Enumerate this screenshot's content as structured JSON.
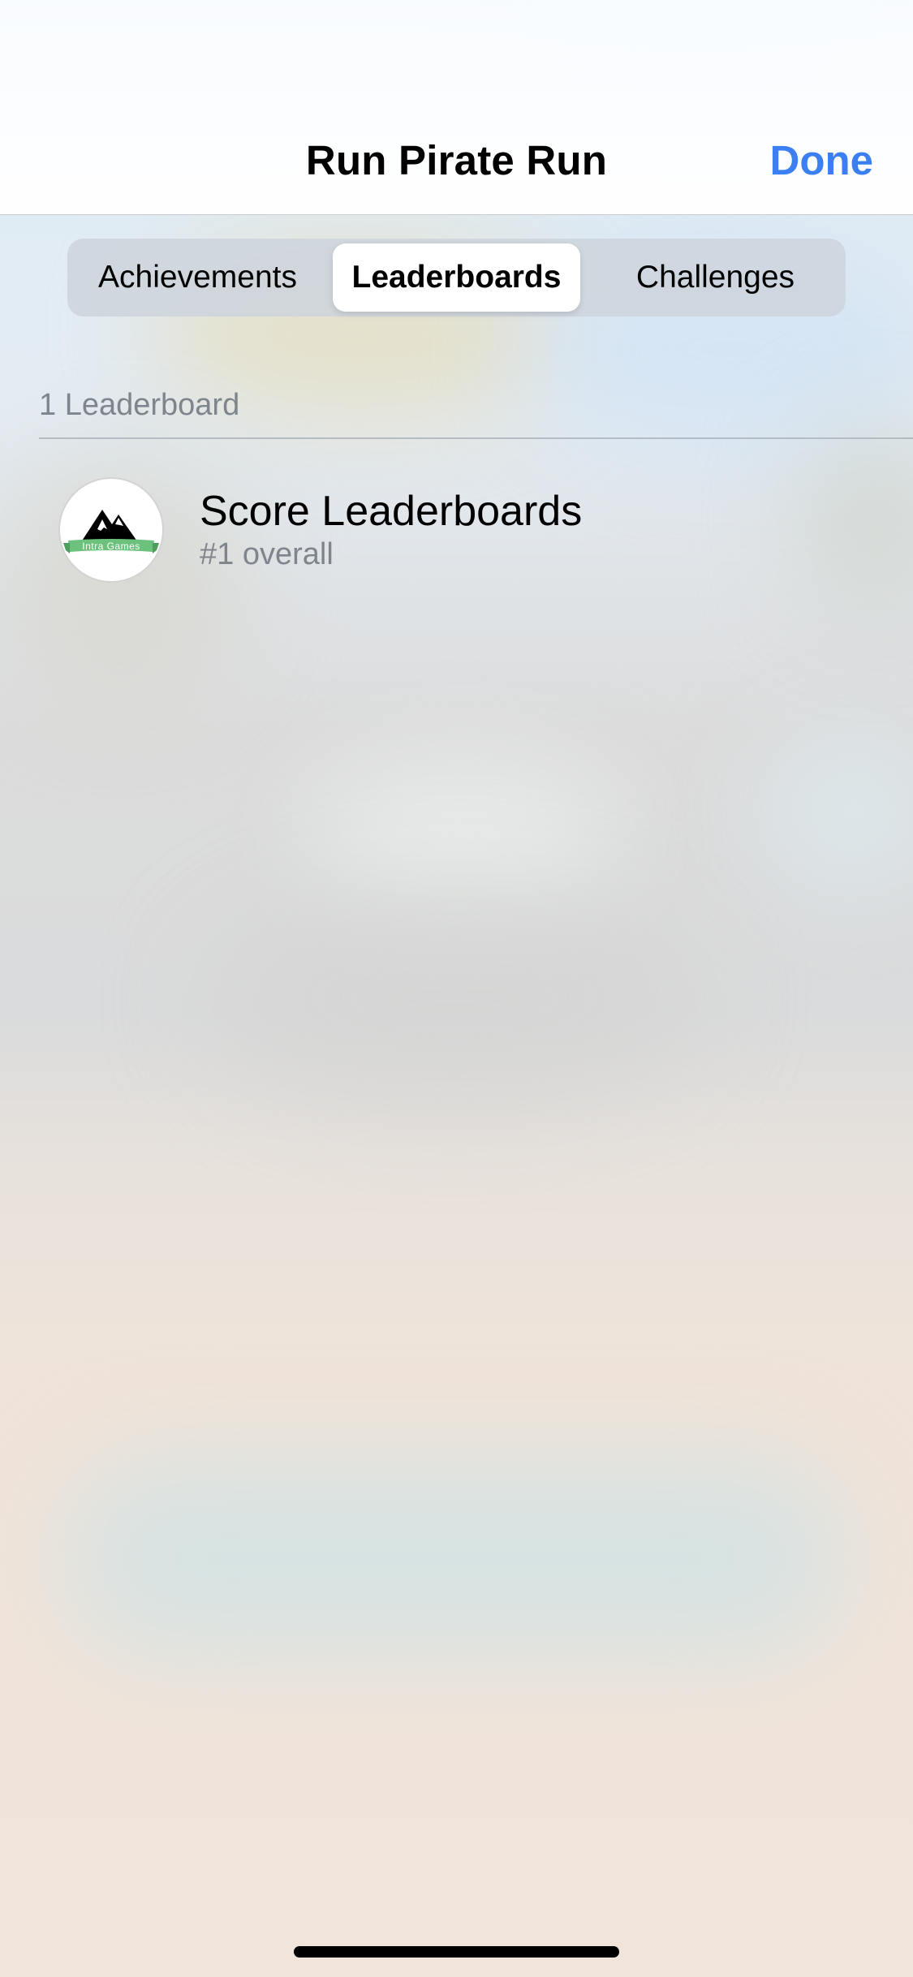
{
  "header": {
    "title": "Run Pirate Run",
    "done_label": "Done"
  },
  "segments": [
    {
      "label": "Achievements",
      "selected": false
    },
    {
      "label": "Leaderboards",
      "selected": true
    },
    {
      "label": "Challenges",
      "selected": false
    }
  ],
  "section": {
    "header": "1 Leaderboard"
  },
  "leaderboards": [
    {
      "title": "Score Leaderboards",
      "subtitle": "#1 overall",
      "icon": "intra-games-mountain-logo-icon",
      "logo_text": "Intra Games"
    }
  ],
  "colors": {
    "accent": "#3b7ff2",
    "logo_ribbon": "#6cc17d",
    "secondary_text": "#7f858c"
  }
}
